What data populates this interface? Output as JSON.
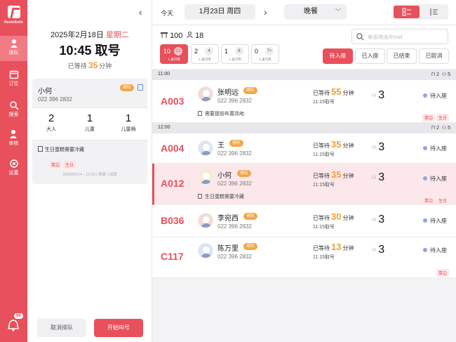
{
  "rail": {
    "logo": "RestoSuite",
    "items": [
      {
        "label": "排队",
        "icon": "queue-icon"
      },
      {
        "label": "订位",
        "icon": "calendar-icon"
      },
      {
        "label": "搜索",
        "icon": "search-icon"
      },
      {
        "label": "审核",
        "icon": "user-check-icon"
      },
      {
        "label": "设置",
        "icon": "gear-icon"
      }
    ],
    "notif_count": "99"
  },
  "left": {
    "date": "2025年2月18日",
    "weekday": "星期二",
    "time_title": "10:45  取号",
    "waited_prefix": "已等待",
    "waited_value": "35",
    "waited_unit": "分钟",
    "customer": {
      "name": "小何",
      "tag": "排队",
      "phone": "022 396 2832",
      "adults": "2",
      "adults_label": "大人",
      "children": "1",
      "children_label": "儿童",
      "highchair": "1",
      "highchair_label": "儿童椅",
      "note": "生日蛋糕需要冷藏",
      "tags": [
        "靠边",
        "生日"
      ],
      "meta": "2025/02/14 - 12:23  |  商家  |  出陵"
    },
    "cancel_btn": "取消排队",
    "call_btn": "开始叫号"
  },
  "topbar": {
    "today": "今天",
    "date": "1月23日  周四",
    "meal": "晚餐"
  },
  "toolbar": {
    "count_total": "100",
    "count_people": "18",
    "search_placeholder": "电话/姓名/Email",
    "tables": [
      {
        "num": "10",
        "count": "22",
        "avail": "1 桌可用"
      },
      {
        "num": "2",
        "count": "4",
        "avail": "1 桌可用"
      },
      {
        "num": "1",
        "count": "6",
        "avail": "1 桌可用"
      },
      {
        "num": "0",
        "count": "7+",
        "avail": "3 桌可用"
      }
    ],
    "filters": [
      "待入座",
      "已入座",
      "已结束",
      "已取消"
    ]
  },
  "groups": [
    {
      "time": "11:00",
      "tables": "2",
      "people": "5"
    },
    {
      "time": "12:00",
      "tables": "2",
      "people": "5"
    }
  ],
  "rows": [
    {
      "id": "A003",
      "name": "张明远",
      "tag": "排队",
      "phone": "022 396 2832",
      "note": "需要提前布置场地",
      "wait_prefix": "已等待",
      "wait": "55",
      "wait_unit": "分钟",
      "time": "11:15取号",
      "people": "3",
      "status": "待入座",
      "tags": [
        "靠边",
        "生日"
      ]
    },
    {
      "id": "A004",
      "name": "王",
      "tag": "排队",
      "phone": "022 396 2832",
      "note": "",
      "wait_prefix": "已等待",
      "wait": "35",
      "wait_unit": "分钟",
      "time": "11:15取号",
      "people": "3",
      "status": "待入座",
      "tags": []
    },
    {
      "id": "A012",
      "name": "小何",
      "tag": "排队",
      "phone": "022 396 2832",
      "note": "生日蛋糕需要冷藏",
      "wait_prefix": "已等待",
      "wait": "35",
      "wait_unit": "分钟",
      "time": "11:15取号",
      "people": "3",
      "status": "待入座",
      "tags": [
        "靠边",
        "生日"
      ]
    },
    {
      "id": "B036",
      "name": "李宛西",
      "tag": "排队",
      "phone": "022 396 2832",
      "note": "",
      "wait_prefix": "已等待",
      "wait": "30",
      "wait_unit": "分钟",
      "time": "11:15取号",
      "people": "3",
      "status": "待入座",
      "tags": []
    },
    {
      "id": "C117",
      "name": "陈万里",
      "tag": "排队",
      "phone": "022 396 2832",
      "note": "",
      "wait_prefix": "已等待",
      "wait": "13",
      "wait_unit": "分钟",
      "time": "11:15取号",
      "people": "3",
      "status": "待入座",
      "tags": [
        "靠边"
      ]
    }
  ],
  "colors": {
    "accent": "#e8505b",
    "wait": "#f0a030",
    "tag": "#f2a64a"
  }
}
